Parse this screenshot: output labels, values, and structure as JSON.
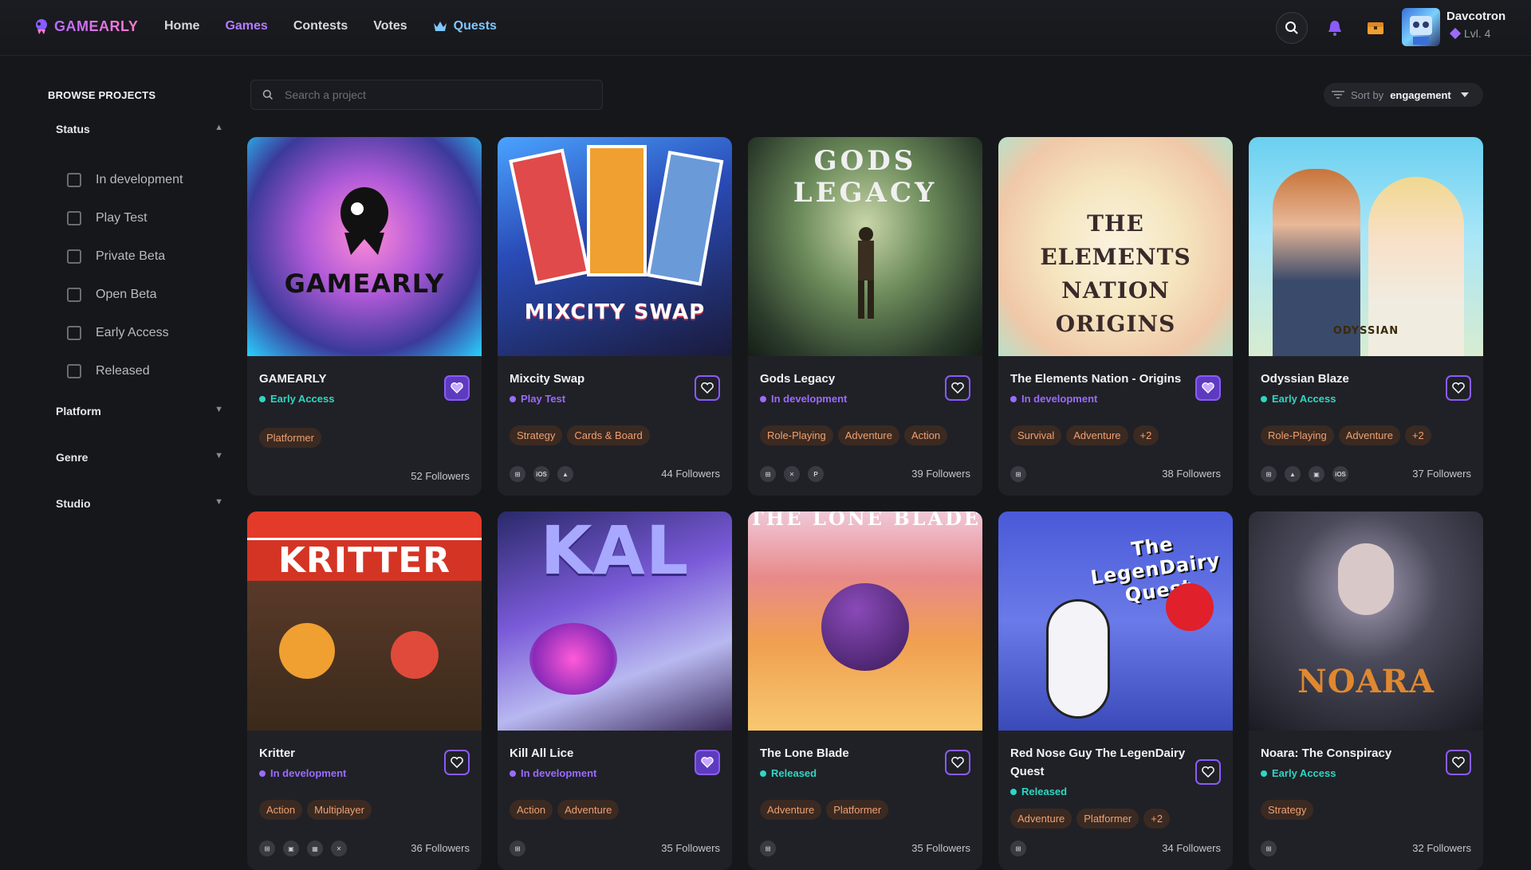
{
  "brand": {
    "name": "GAMEARLY"
  },
  "nav": {
    "items": [
      "Home",
      "Games",
      "Contests",
      "Votes",
      "Quests"
    ]
  },
  "user": {
    "name": "Davcotron",
    "level": "Lvl. 4"
  },
  "sidebar": {
    "title": "BROWSE PROJECTS",
    "status_title": "Status",
    "statuses": [
      "In development",
      "Play Test",
      "Private Beta",
      "Open Beta",
      "Early Access",
      "Released"
    ],
    "platform_title": "Platform",
    "genre_title": "Genre",
    "studio_title": "Studio"
  },
  "search": {
    "placeholder": "Search a project"
  },
  "sort": {
    "label": "Sort by",
    "value": "engagement"
  },
  "colors": {
    "accent": "#8b5bff",
    "early_access": "#2fd6c4",
    "in_development": "#9b6bff",
    "play_test": "#9b6bff",
    "released": "#2fd6c4"
  },
  "cards": [
    {
      "title": "GAMEARLY",
      "status": "Early Access",
      "status_color": "#2fd6c4",
      "tags": [
        "Platformer"
      ],
      "platforms": [],
      "followers": "52 Followers",
      "fav": true,
      "cover_text": "GAMEARLY"
    },
    {
      "title": "Mixcity Swap",
      "status": "Play Test",
      "status_color": "#9b6bff",
      "tags": [
        "Strategy",
        "Cards & Board"
      ],
      "platforms": [
        "windows",
        "ios",
        "android"
      ],
      "followers": "44 Followers",
      "fav": false,
      "cover_text": "MIXCITY SWAP"
    },
    {
      "title": "Gods Legacy",
      "status": "In development",
      "status_color": "#9b6bff",
      "tags": [
        "Role-Playing",
        "Adventure",
        "Action"
      ],
      "platforms": [
        "windows",
        "xbox",
        "playstation"
      ],
      "followers": "39 Followers",
      "fav": false,
      "cover_text": "GODS LEGACY"
    },
    {
      "title": "The Elements Nation - Origins",
      "status": "In development",
      "status_color": "#9b6bff",
      "tags": [
        "Survival",
        "Adventure",
        "+2"
      ],
      "platforms": [
        "windows"
      ],
      "followers": "38 Followers",
      "fav": true,
      "cover_text": "THE ELEMENTS NATION ORIGINS"
    },
    {
      "title": "Odyssian Blaze",
      "status": "Early Access",
      "status_color": "#2fd6c4",
      "tags": [
        "Role-Playing",
        "Adventure",
        "+2"
      ],
      "platforms": [
        "windows",
        "android",
        "mobile",
        "ios"
      ],
      "followers": "37 Followers",
      "fav": false,
      "cover_text": "ODYSSIAN"
    },
    {
      "title": "Kritter",
      "status": "In development",
      "status_color": "#9b6bff",
      "tags": [
        "Action",
        "Multiplayer"
      ],
      "platforms": [
        "windows",
        "mobile",
        "switch",
        "xbox"
      ],
      "followers": "36 Followers",
      "fav": false,
      "cover_text": "KRITTER"
    },
    {
      "title": "Kill All Lice",
      "status": "In development",
      "status_color": "#9b6bff",
      "tags": [
        "Action",
        "Adventure"
      ],
      "platforms": [
        "windows"
      ],
      "followers": "35 Followers",
      "fav": true,
      "cover_text": "KAL"
    },
    {
      "title": "The Lone Blade",
      "status": "Released",
      "status_color": "#2fd6c4",
      "tags": [
        "Adventure",
        "Platformer"
      ],
      "platforms": [
        "windows"
      ],
      "followers": "35 Followers",
      "fav": false,
      "cover_text": "THE LONE BLADE"
    },
    {
      "title": "Red Nose Guy The LegenDairy Quest",
      "status": "Released",
      "status_color": "#2fd6c4",
      "tags": [
        "Adventure",
        "Platformer",
        "+2"
      ],
      "platforms": [
        "windows"
      ],
      "followers": "34 Followers",
      "fav": false,
      "cover_text": "The LegenDairy Quest"
    },
    {
      "title": "Noara: The Conspiracy",
      "status": "Early Access",
      "status_color": "#2fd6c4",
      "tags": [
        "Strategy"
      ],
      "platforms": [
        "windows"
      ],
      "followers": "32 Followers",
      "fav": false,
      "cover_text": "NOARA"
    }
  ]
}
